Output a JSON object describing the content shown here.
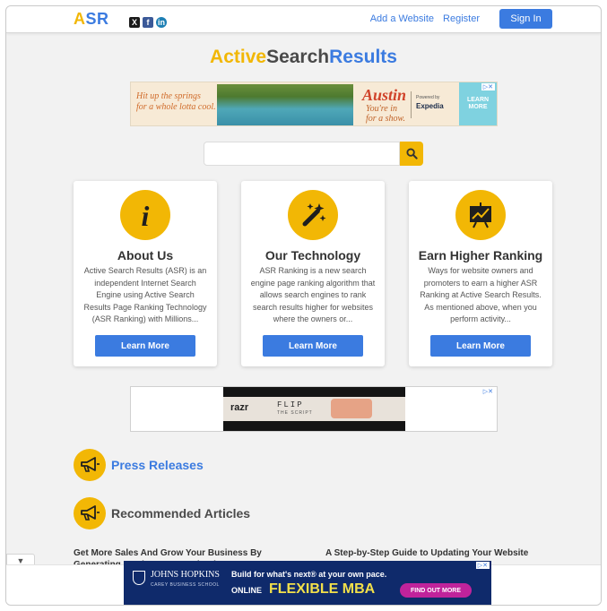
{
  "header": {
    "logo_a": "A",
    "logo_sr": "SR",
    "social": [
      "x-icon",
      "facebook-icon",
      "linkedin-icon"
    ],
    "social_glyphs": {
      "x": "X",
      "fb": "f",
      "li": "in"
    },
    "links": [
      "Add a Website",
      "Register"
    ],
    "signin_label": "Sign In"
  },
  "brand": {
    "part1": "Active",
    "part2": "Search",
    "part3": "Results"
  },
  "ad_top": {
    "text": "Hit up the springs for a whole lotta cool.",
    "text_line1": "Hit up the springs",
    "text_line2": "for a whole lotta cool.",
    "austin": "Austin",
    "show_line1": "You're in",
    "show_line2": "for a show.",
    "powered": "Powered by",
    "expedia": "Expedia",
    "learn_line1": "LEARN",
    "learn_line2": "MORE"
  },
  "search": {
    "value": "",
    "placeholder": ""
  },
  "cards": [
    {
      "title": "About Us",
      "text": "Active Search Results (ASR) is an independent Internet Search Engine using Active Search Results Page Ranking Technology (ASR Ranking) with Millions...",
      "button": "Learn More",
      "icon": "info-icon"
    },
    {
      "title": "Our Technology",
      "text": "ASR Ranking is a new search engine page ranking algorithm that allows search engines to rank search results higher for websites where the owners or...",
      "button": "Learn More",
      "icon": "magic-wand-icon"
    },
    {
      "title": "Earn Higher Ranking",
      "text": "Ways for website owners and promoters to earn a higher ASR Ranking at Active Search Results. As mentioned above, when you perform activity...",
      "button": "Learn More",
      "icon": "chart-board-icon"
    }
  ],
  "ad_middle": {
    "brand": "razr",
    "line1": "FLIP",
    "line2": "THE SCRIPT"
  },
  "sections": {
    "press": "Press Releases",
    "recommended": "Recommended Articles"
  },
  "articles": [
    "Get More Sales And Grow Your Business By Generating Leads From Facebook",
    "A Step-by-Step Guide to Updating Your Website"
  ],
  "ad_bottom": {
    "school": "JOHNS HOPKINS",
    "school_sub": "CAREY BUSINESS SCHOOL",
    "headline": "Build for what's next® at your own pace.",
    "online": "ONLINE",
    "mba": "FLEXIBLE MBA",
    "cta": "FIND OUT MORE"
  },
  "colors": {
    "accent_yellow": "#f2b705",
    "accent_blue": "#3b7be0"
  }
}
